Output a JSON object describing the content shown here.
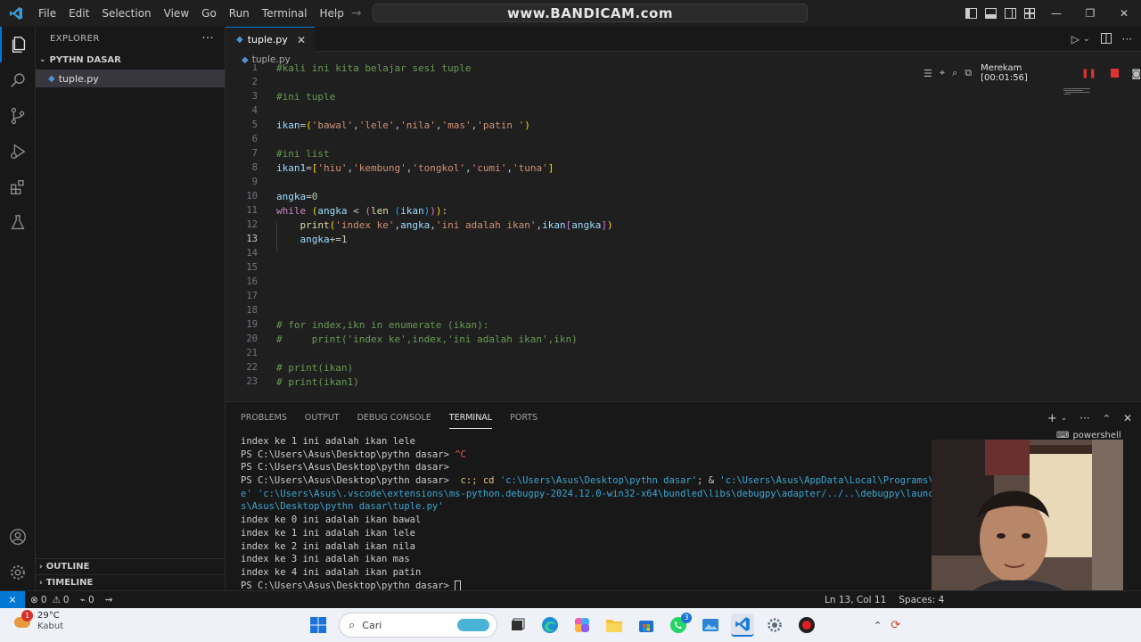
{
  "titlebar": {
    "menu": [
      "File",
      "Edit",
      "Selection",
      "View",
      "Go",
      "Run",
      "Terminal",
      "Help"
    ],
    "watermark": "www.BANDICAM.com"
  },
  "sidebar": {
    "title": "EXPLORER",
    "folder": "PYTHN DASAR",
    "file": "tuple.py",
    "outline": "OUTLINE",
    "timeline": "TIMELINE"
  },
  "editor": {
    "tab_label": "tuple.py",
    "breadcrumb": "tuple.py",
    "cursor_line": 13
  },
  "code_lines": [
    {
      "n": "1",
      "text": "#kali ini kita belajar sesi tuple"
    },
    {
      "n": "2",
      "text": ""
    },
    {
      "n": "3",
      "text": "#ini tuple"
    },
    {
      "n": "4",
      "text": ""
    },
    {
      "n": "5",
      "text": "ikan=('bawal','lele','nila','mas','patin ')"
    },
    {
      "n": "6",
      "text": ""
    },
    {
      "n": "7",
      "text": "#ini list"
    },
    {
      "n": "8",
      "text": "ikan1=['hiu','kembung','tongkol','cumi','tuna']"
    },
    {
      "n": "9",
      "text": ""
    },
    {
      "n": "10",
      "text": "angka=0"
    },
    {
      "n": "11",
      "text": "while (angka < (len (ikan))):"
    },
    {
      "n": "12",
      "text": "    print('index ke',angka,'ini adalah ikan',ikan[angka])"
    },
    {
      "n": "13",
      "text": "    angka+=1"
    },
    {
      "n": "14",
      "text": ""
    },
    {
      "n": "15",
      "text": ""
    },
    {
      "n": "16",
      "text": ""
    },
    {
      "n": "17",
      "text": ""
    },
    {
      "n": "18",
      "text": ""
    },
    {
      "n": "19",
      "text": "# for index,ikn in enumerate (ikan):"
    },
    {
      "n": "20",
      "text": "#     print('index ke',index,'ini adalah ikan',ikn)"
    },
    {
      "n": "21",
      "text": ""
    },
    {
      "n": "22",
      "text": "# print(ikan)"
    },
    {
      "n": "23",
      "text": "# print(ikan1)"
    }
  ],
  "recorder": {
    "label": "Merekam [00:01:56]"
  },
  "panel": {
    "tabs": [
      "PROBLEMS",
      "OUTPUT",
      "DEBUG CONSOLE",
      "TERMINAL",
      "PORTS"
    ],
    "active_tab": "TERMINAL",
    "shell": "powershell",
    "lines": [
      "index ke 1 ini adalah ikan lele",
      "PS C:\\Users\\Asus\\Desktop\\pythn dasar> ^C",
      "PS C:\\Users\\Asus\\Desktop\\pythn dasar>",
      "PS C:\\Users\\Asus\\Desktop\\pythn dasar>  c:; cd 'c:\\Users\\Asus\\Desktop\\pythn dasar'; & 'c:\\Users\\Asus\\AppData\\Local\\Programs\\Python",
      "e' 'c:\\Users\\Asus\\.vscode\\extensions\\ms-python.debugpy-2024.12.0-win32-x64\\bundled\\libs\\debugpy\\adapter/../..\\debugpy\\launcher' '",
      "s\\Asus\\Desktop\\pythn dasar\\tuple.py'",
      "index ke 0 ini adalah ikan bawal",
      "index ke 1 ini adalah ikan lele",
      "index ke 2 ini adalah ikan nila",
      "index ke 3 ini adalah ikan mas",
      "index ke 4 ini adalah ikan patin",
      "PS C:\\Users\\Asus\\Desktop\\pythn dasar> "
    ]
  },
  "statusbar": {
    "errors": "0",
    "warnings": "0",
    "ports": "0",
    "position": "Ln 13, Col 11",
    "spaces": "Spaces: 4"
  },
  "taskbar": {
    "weather_temp": "29°C",
    "weather_cond": "Kabut",
    "weather_badge": "1",
    "search_placeholder": "Cari",
    "whatsapp_badge": "3"
  },
  "colors": {
    "accent": "#0078d4",
    "editor_bg": "#1f1f1f",
    "record_red": "#e03030"
  }
}
